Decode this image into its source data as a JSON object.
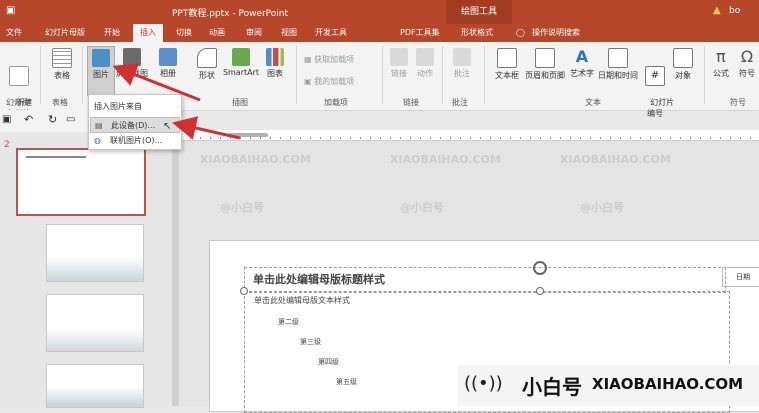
{
  "titlebar": {
    "title": "PPT教程.pptx - PowerPoint",
    "context_tool": "绘图工具",
    "user": "bo"
  },
  "tabs": [
    {
      "label": "文件"
    },
    {
      "label": "幻灯片母版"
    },
    {
      "label": "开始"
    },
    {
      "label": "插入",
      "active": true
    },
    {
      "label": "切换"
    },
    {
      "label": "动画"
    },
    {
      "label": "审阅"
    },
    {
      "label": "视图"
    },
    {
      "label": "开发工具"
    },
    {
      "label": "PDF工具集"
    },
    {
      "label": "形状格式"
    },
    {
      "label": "操作说明搜索"
    }
  ],
  "ribbon": {
    "new_slide": "新建\n幻灯片",
    "new_slide_group": "幻灯片",
    "table": "表格",
    "table_group": "表格",
    "pictures": "图片",
    "screenshot": "屏幕截图",
    "album": "相册",
    "shapes": "形状",
    "smartart": "SmartArt",
    "chart": "图表",
    "illus_group": "插图",
    "get_addins": "获取加载项",
    "my_addins": "我的加载项",
    "addins_group": "加载项",
    "link": "链接",
    "action": "动作",
    "links_group": "链接",
    "comment": "批注",
    "comments_group": "批注",
    "textbox": "文本框",
    "header_footer": "页眉和页脚",
    "wordart": "艺术字",
    "datetime": "日期和时间",
    "slide_number": "幻灯片\n编号",
    "object": "对象",
    "text_group": "文本",
    "equation": "公式",
    "symbol": "符号",
    "symbols_group": "符号"
  },
  "dropdown": {
    "header": "插入图片来自",
    "items": [
      "此设备(D)...",
      "联机图片(O)..."
    ]
  },
  "slide_pane": {
    "selected_number": "2"
  },
  "slide": {
    "title": "单击此处编辑母版标题样式",
    "date_box": "日期",
    "bullets": [
      "单击此处编辑母版文本样式",
      "第二级",
      "第三级",
      "第四级",
      "第五级"
    ]
  },
  "watermark": {
    "text": "XIAOBAIHAO.COM",
    "cn": "@小白号"
  },
  "brand": {
    "name": "小白号",
    "url": "XIAOBAIHAO.COM"
  },
  "colors": {
    "accent": "#b7472a",
    "arrow": "#d32f2f"
  }
}
